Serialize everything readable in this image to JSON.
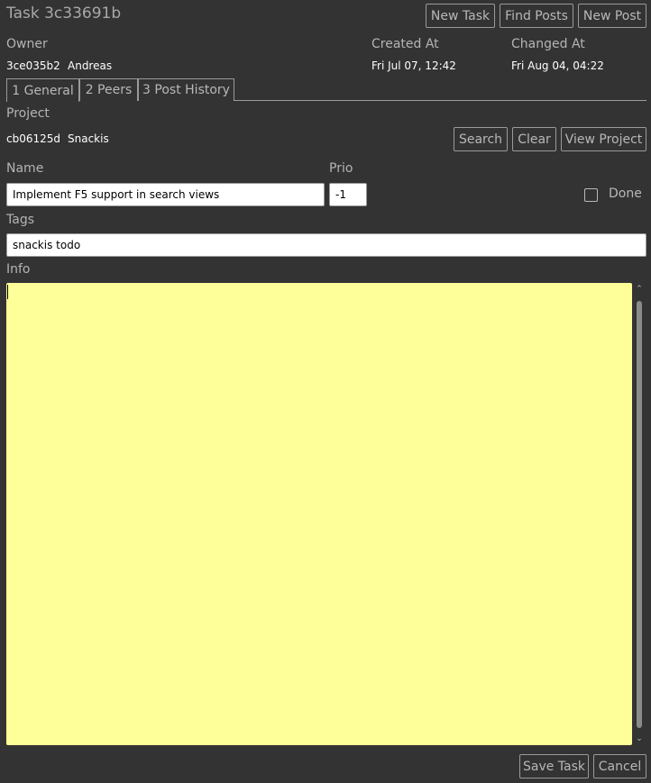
{
  "header": {
    "title": "Task 3c33691b",
    "new_task": "New Task",
    "find_posts": "Find Posts",
    "new_post": "New Post"
  },
  "owner": {
    "label": "Owner",
    "id": "3ce035b2",
    "name": "Andreas"
  },
  "created": {
    "label": "Created At",
    "value": "Fri Jul 07, 12:42"
  },
  "changed": {
    "label": "Changed At",
    "value": "Fri Aug 04, 04:22"
  },
  "tabs": [
    {
      "label": "1 General"
    },
    {
      "label": "2 Peers"
    },
    {
      "label": "3 Post History"
    }
  ],
  "project": {
    "label": "Project",
    "id": "cb06125d",
    "name": "Snackis",
    "search": "Search",
    "clear": "Clear",
    "view": "View Project"
  },
  "name_field": {
    "label": "Name",
    "value": "Implement F5 support in search views"
  },
  "prio_field": {
    "label": "Prio",
    "value": "-1"
  },
  "done": {
    "label": "Done",
    "checked": false
  },
  "tags_field": {
    "label": "Tags",
    "value": "snackis todo"
  },
  "info": {
    "label": "Info",
    "value": "",
    "background": "#ffff99"
  },
  "footer": {
    "save": "Save Task",
    "cancel": "Cancel"
  }
}
